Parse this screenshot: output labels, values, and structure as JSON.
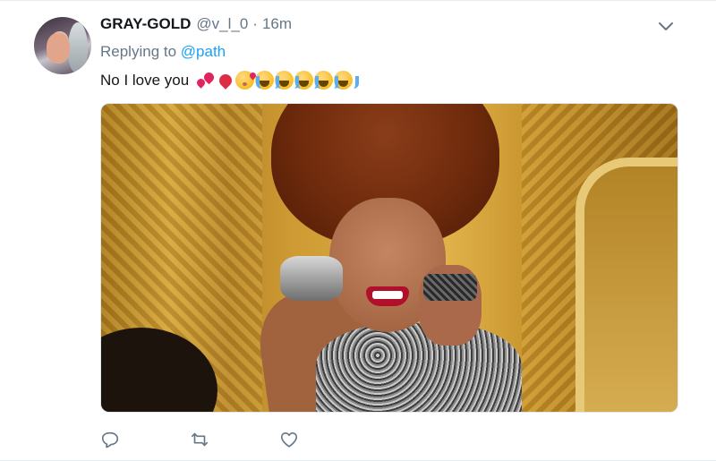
{
  "tweet": {
    "display_name": "GRAY-GOLD",
    "handle": "@v_l_0",
    "separator": "·",
    "timestamp": "16m",
    "reply_prefix": "Replying to ",
    "reply_mention": "@path",
    "text": "No I love you",
    "emojis": [
      "two-hearts",
      "red-heart",
      "face-blowing-kiss",
      "loudly-crying-face",
      "loudly-crying-face",
      "loudly-crying-face",
      "loudly-crying-face",
      "loudly-crying-face"
    ]
  },
  "actions": {
    "reply_icon": "reply-icon",
    "retweet_icon": "retweet-icon",
    "like_icon": "like-icon"
  },
  "colors": {
    "text": "#14171a",
    "muted": "#657786",
    "link": "#1da1f2",
    "icon": "#657786"
  }
}
